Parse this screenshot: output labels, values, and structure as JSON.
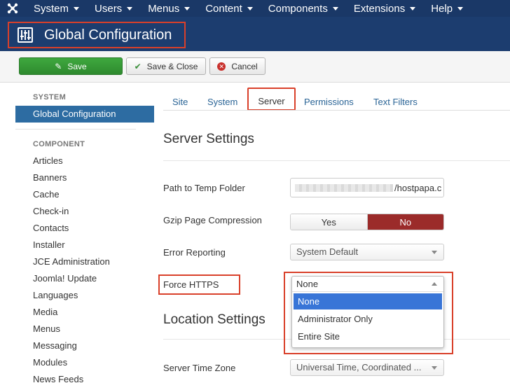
{
  "topbar": {
    "menus": [
      "System",
      "Users",
      "Menus",
      "Content",
      "Components",
      "Extensions",
      "Help"
    ]
  },
  "page": {
    "title": "Global Configuration"
  },
  "toolbar": {
    "save": "Save",
    "save_close": "Save & Close",
    "cancel": "Cancel"
  },
  "sidebar": {
    "system_heading": "SYSTEM",
    "active_item": "Global Configuration",
    "component_heading": "COMPONENT",
    "items": [
      "Articles",
      "Banners",
      "Cache",
      "Check-in",
      "Contacts",
      "Installer",
      "JCE Administration",
      "Joomla! Update",
      "Languages",
      "Media",
      "Menus",
      "Messaging",
      "Modules",
      "News Feeds"
    ]
  },
  "tabs": [
    "Site",
    "System",
    "Server",
    "Permissions",
    "Text Filters"
  ],
  "active_tab": "Server",
  "server_settings": {
    "heading": "Server Settings",
    "temp_folder_label": "Path to Temp Folder",
    "temp_folder_value": "/hostpapa.c",
    "gzip_label": "Gzip Page Compression",
    "gzip_yes": "Yes",
    "gzip_no": "No",
    "error_label": "Error Reporting",
    "error_value": "System Default",
    "https_label": "Force HTTPS",
    "https_value": "None",
    "https_options": [
      "None",
      "Administrator Only",
      "Entire Site"
    ]
  },
  "location_settings": {
    "heading": "Location Settings",
    "tz_label": "Server Time Zone",
    "tz_value": "Universal Time, Coordinated ..."
  },
  "colors": {
    "topbar": "#1a3867",
    "titlebar": "#1c3d6f",
    "accent_red": "#d9402a",
    "save_green": "#3ea83e",
    "no_red": "#9b2b2a",
    "link": "#2a6496"
  }
}
